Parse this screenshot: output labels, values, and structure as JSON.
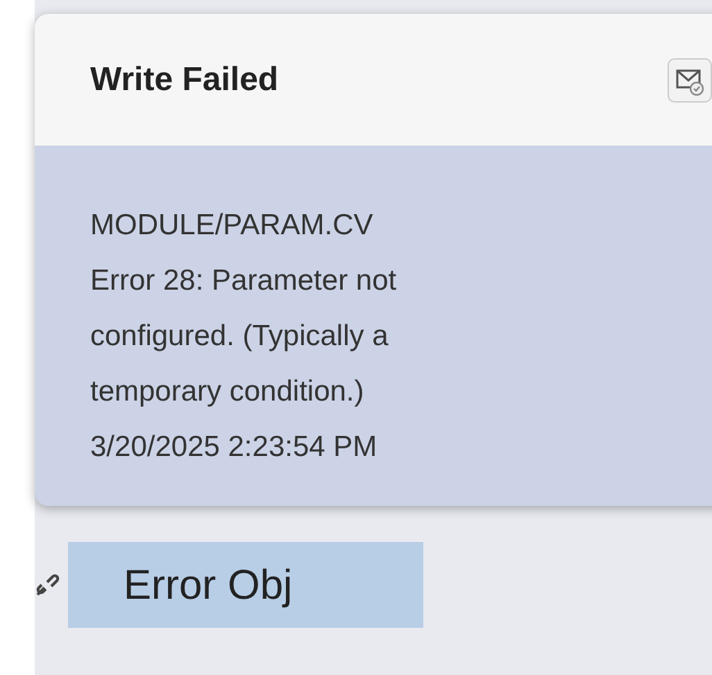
{
  "card": {
    "title": "Write Failed",
    "lines": [
      "MODULE/PARAM.CV",
      "Error 28: Parameter not",
      "configured. (Typically a",
      "temporary condition.)",
      "3/20/2025 2:23:54 PM"
    ]
  },
  "object_label": "Error Obj"
}
